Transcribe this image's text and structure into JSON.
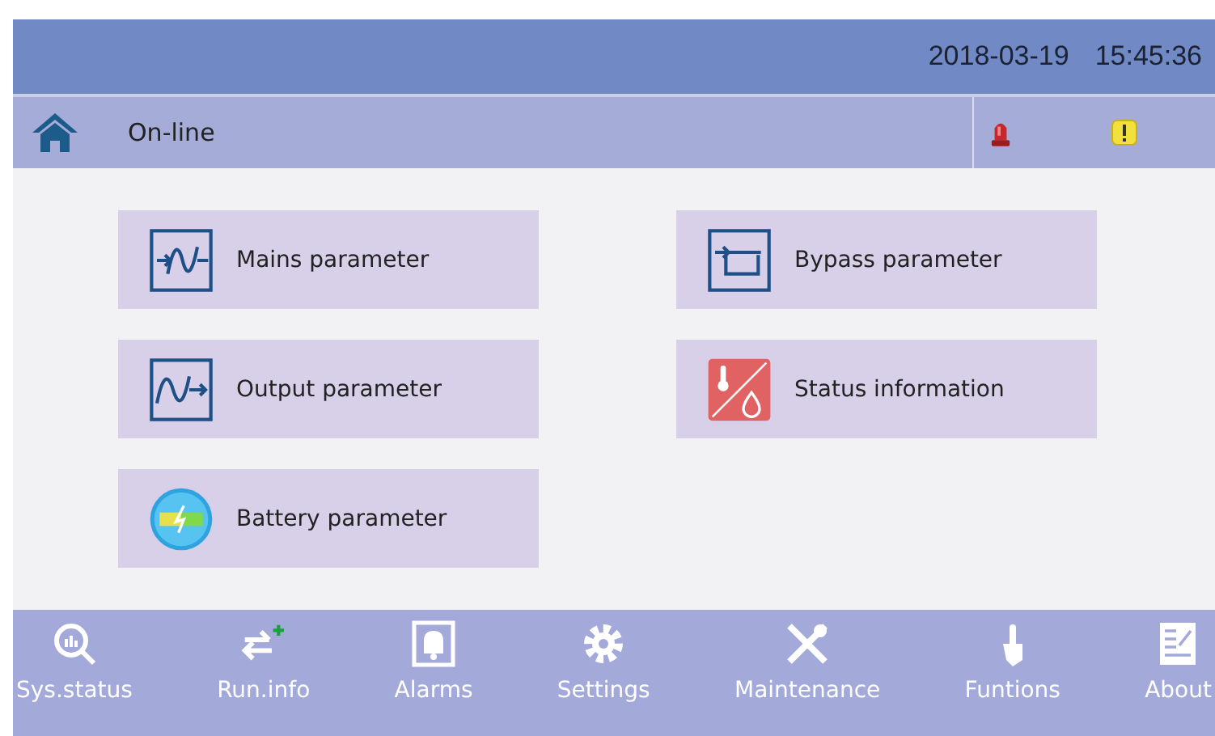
{
  "header": {
    "date": "2018-03-19",
    "time": "15:45:36"
  },
  "status_bar": {
    "mode": "On-line"
  },
  "menu": [
    {
      "label": "Mains parameter",
      "kind": "mains"
    },
    {
      "label": "Bypass parameter",
      "kind": "bypass"
    },
    {
      "label": "Output parameter",
      "kind": "output"
    },
    {
      "label": "Status information",
      "kind": "status"
    },
    {
      "label": "Battery parameter",
      "kind": "battery"
    }
  ],
  "nav": [
    {
      "label": "Sys.status",
      "kind": "sysstatus"
    },
    {
      "label": "Run.info",
      "kind": "runinfo"
    },
    {
      "label": "Alarms",
      "kind": "alarms"
    },
    {
      "label": "Settings",
      "kind": "settings"
    },
    {
      "label": "Maintenance",
      "kind": "maintenance"
    },
    {
      "label": "Funtions",
      "kind": "functions"
    },
    {
      "label": "About",
      "kind": "about"
    }
  ]
}
